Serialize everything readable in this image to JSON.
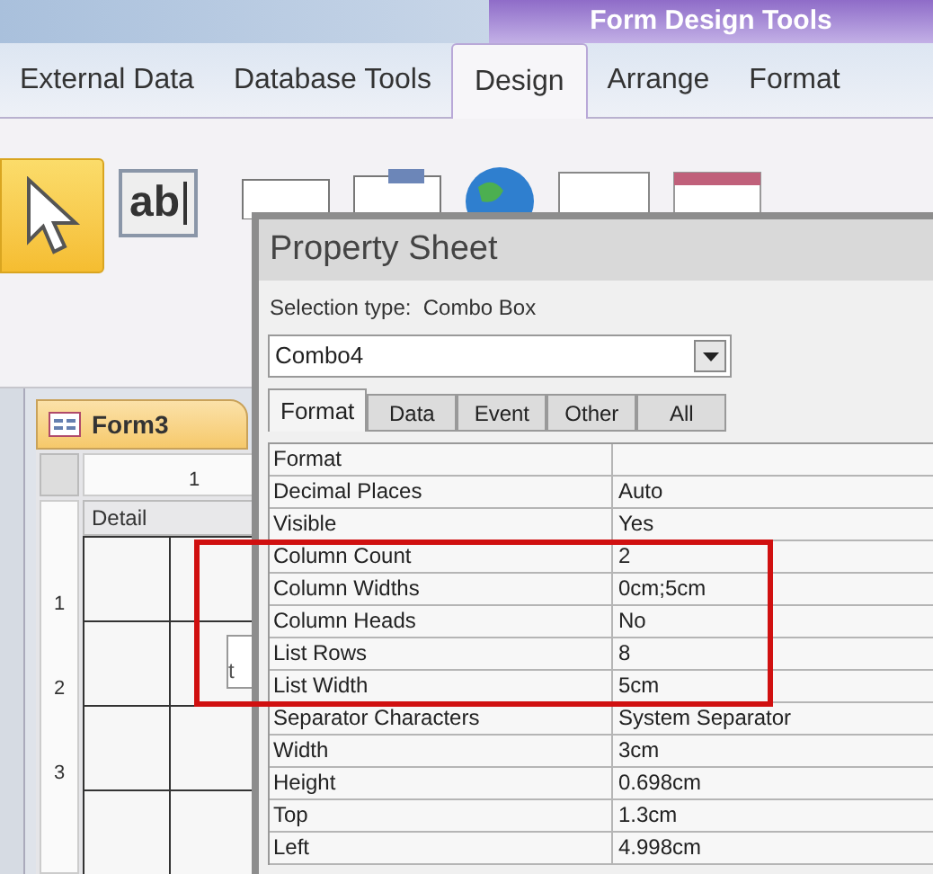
{
  "ribbon": {
    "contextual_title": "Form Design Tools",
    "tabs": [
      {
        "label": "External Data",
        "selected": false
      },
      {
        "label": "Database Tools",
        "selected": false
      },
      {
        "label": "Design",
        "selected": true
      },
      {
        "label": "Arrange",
        "selected": false
      },
      {
        "label": "Format",
        "selected": false
      }
    ],
    "textbox_tool": "ab"
  },
  "document_tab": {
    "label": "Form3"
  },
  "ruler": {
    "label": "1"
  },
  "section": {
    "label": "Detail"
  },
  "vertical_ruler": [
    "1",
    "2",
    "3"
  ],
  "control_fragment": "t",
  "property_sheet": {
    "title": "Property Sheet",
    "selection_type": "Selection type:  Combo Box",
    "selector": "Combo4",
    "tabs": [
      {
        "label": "Format",
        "selected": true
      },
      {
        "label": "Data",
        "selected": false
      },
      {
        "label": "Event",
        "selected": false
      },
      {
        "label": "Other",
        "selected": false
      },
      {
        "label": "All",
        "selected": false
      }
    ],
    "properties": [
      {
        "name": "Format"
      },
      {
        "name": "Decimal Places",
        "value": "Auto"
      },
      {
        "name": "Visible",
        "value": "Yes"
      },
      {
        "name": "Column Count",
        "value": "2"
      },
      {
        "name": "Column Widths",
        "value": "0cm;5cm"
      },
      {
        "name": "Column Heads",
        "value": "No"
      },
      {
        "name": "List Rows",
        "value": "8"
      },
      {
        "name": "List Width",
        "value": "5cm"
      },
      {
        "name": "Separator Characters",
        "value": "System Separator"
      },
      {
        "name": "Width",
        "value": "3cm"
      },
      {
        "name": "Height",
        "value": "0.698cm"
      },
      {
        "name": "Top",
        "value": "1.3cm"
      },
      {
        "name": "Left",
        "value": "4.998cm"
      }
    ]
  }
}
